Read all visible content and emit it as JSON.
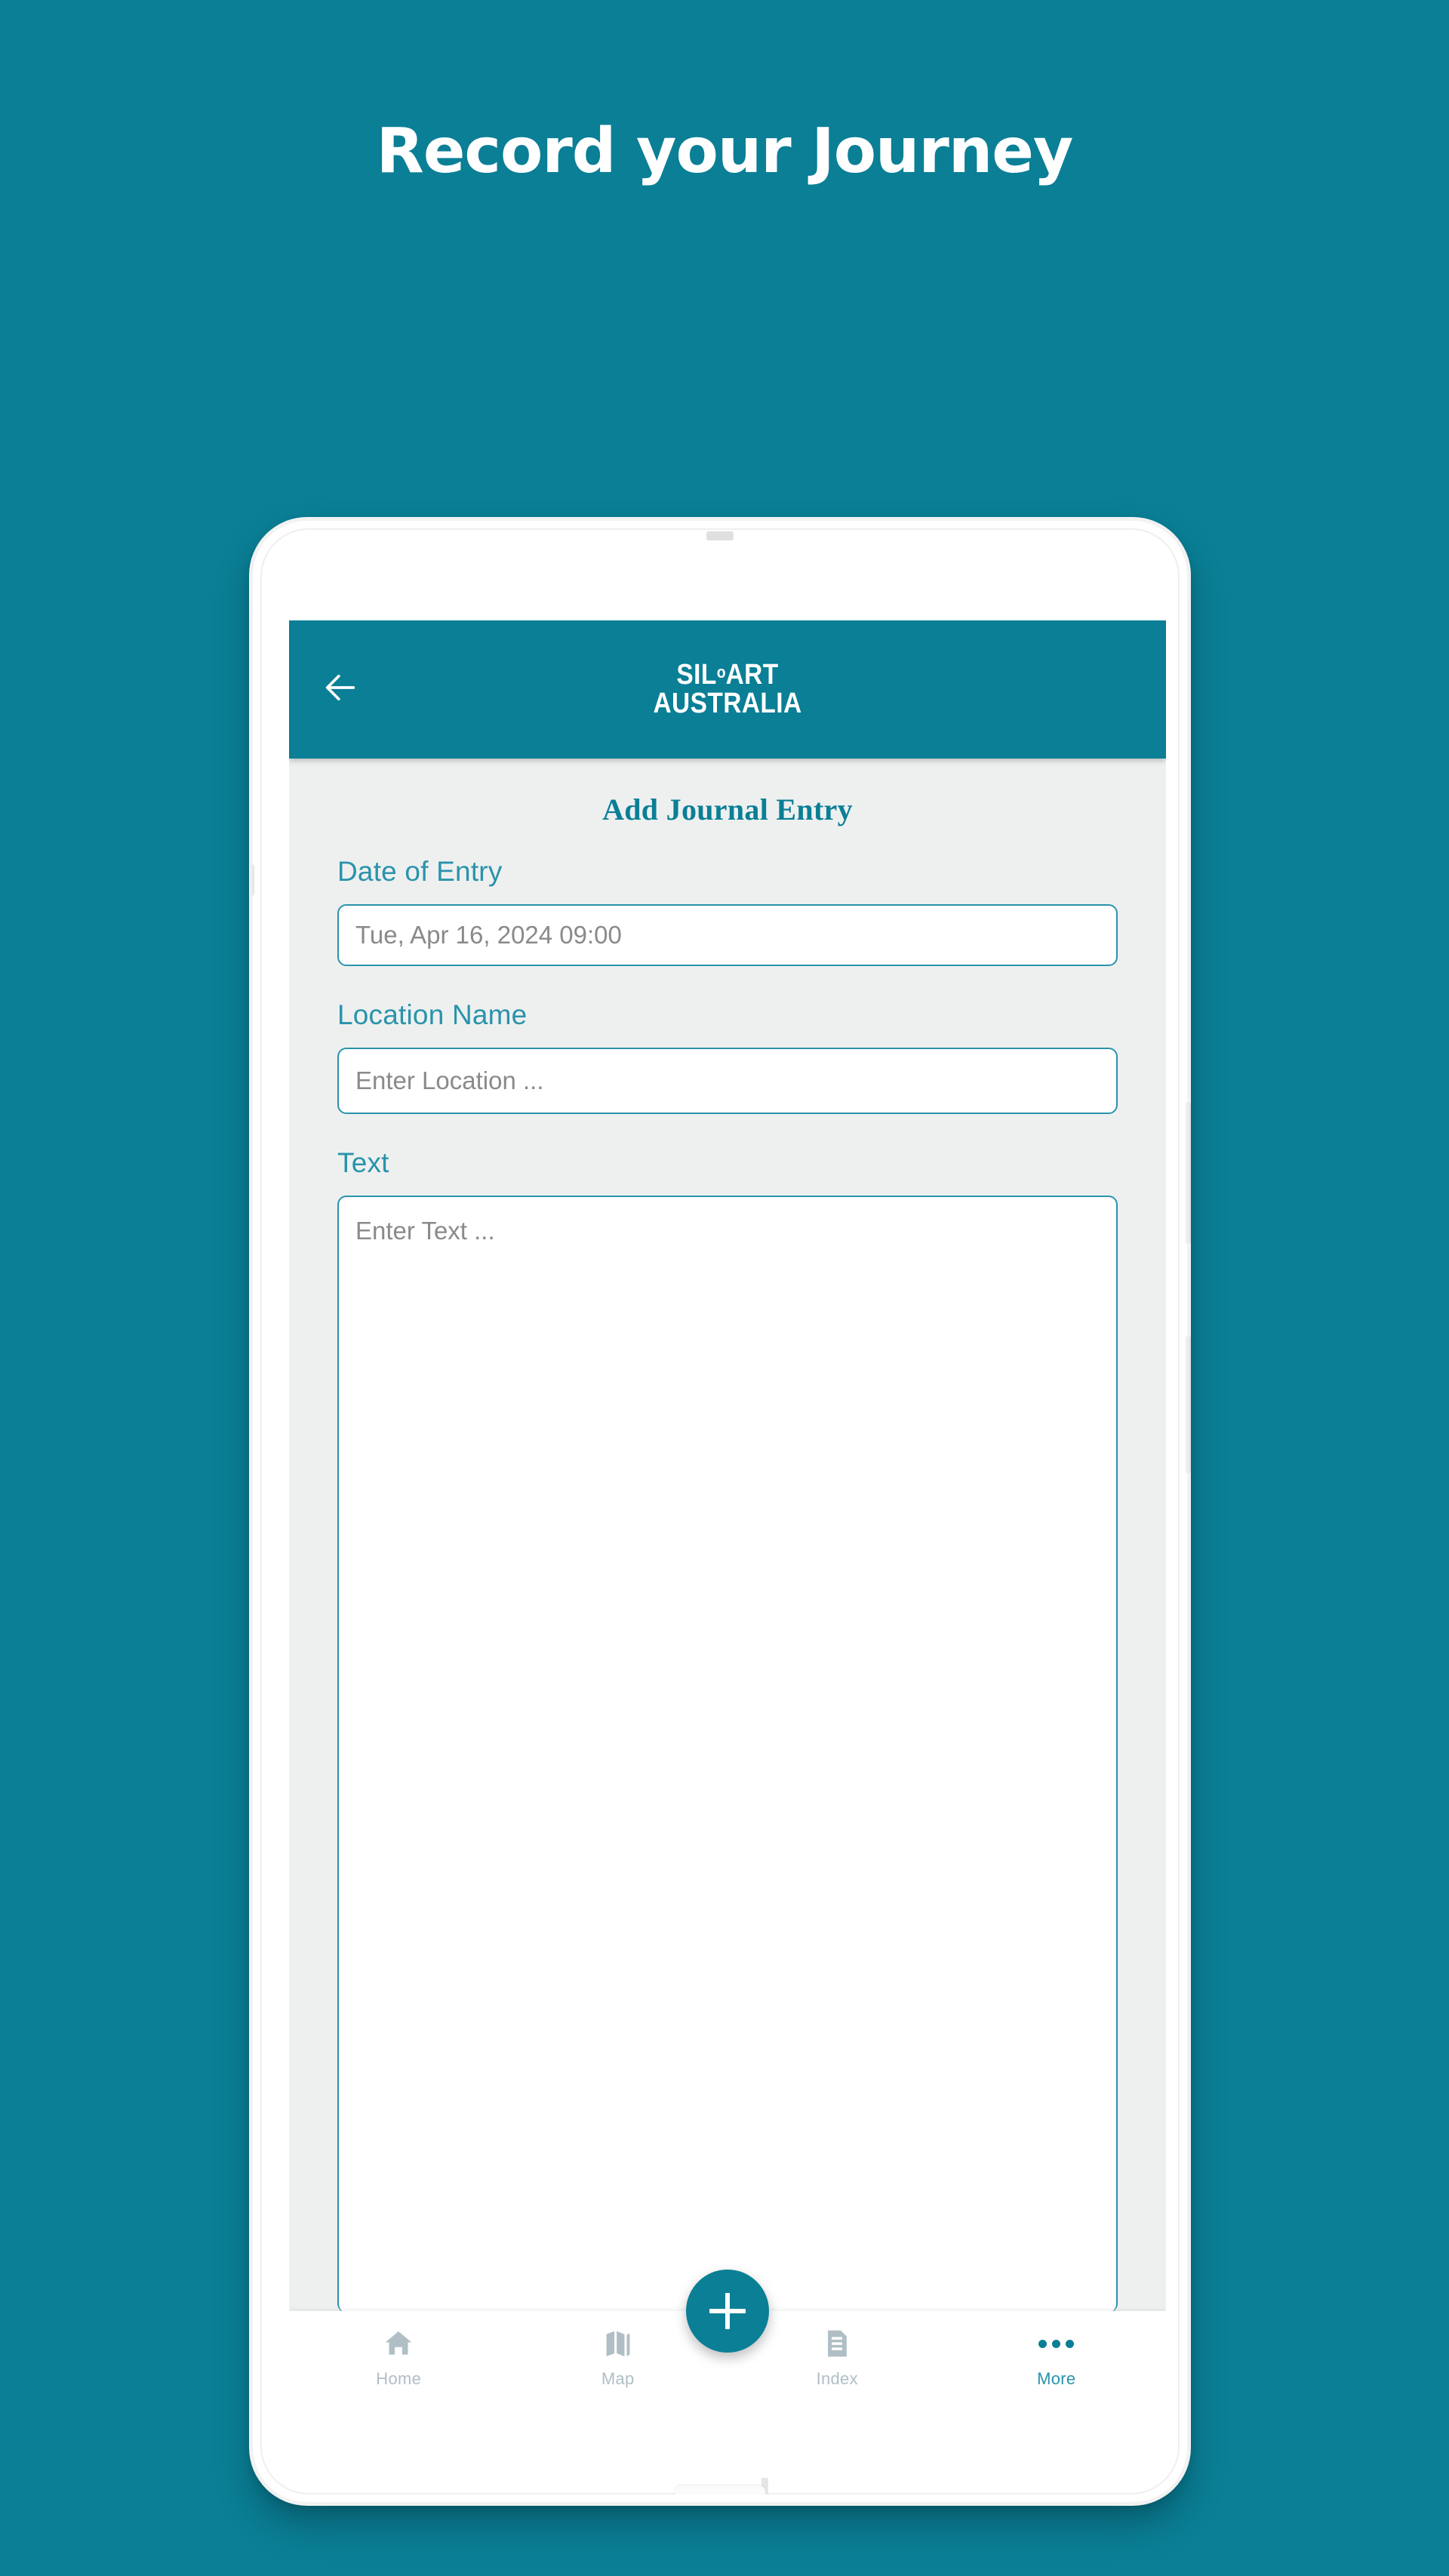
{
  "promo": {
    "headline": "Record your Journey"
  },
  "theme": {
    "brand_teal": "#0a7f96",
    "accent_teal": "#2a93ab",
    "screen_background": "#eef0f0",
    "nav_inactive": "#b0bec5",
    "placeholder_gray": "#8a8a8a",
    "white": "#ffffff"
  },
  "app_bar": {
    "back_icon": "arrow-left-icon",
    "logo_line_1_prefix": "SIL",
    "logo_line_1_circle": "o",
    "logo_line_1_suffix": "ART",
    "logo_line_2": "AUSTRALIA"
  },
  "form": {
    "title": "Add Journal Entry",
    "fields": [
      {
        "label": "Date of Entry",
        "name": "date-of-entry",
        "value": "Tue, Apr 16, 2024 09:00",
        "type": "datetime"
      },
      {
        "label": "Location Name",
        "name": "location-name",
        "placeholder": "Enter Location ...",
        "type": "text"
      },
      {
        "label": "Text",
        "name": "journal-text",
        "placeholder": "Enter Text ...",
        "type": "textarea"
      }
    ]
  },
  "fab": {
    "icon": "plus-icon",
    "label": "+"
  },
  "bottom_nav": {
    "items": [
      {
        "label": "Home",
        "icon": "home-icon",
        "active": false
      },
      {
        "label": "Map",
        "icon": "map-icon",
        "active": false
      },
      {
        "label": "Index",
        "icon": "document-icon",
        "active": false
      },
      {
        "label": "More",
        "icon": "more-dots-icon",
        "active": true
      }
    ]
  }
}
